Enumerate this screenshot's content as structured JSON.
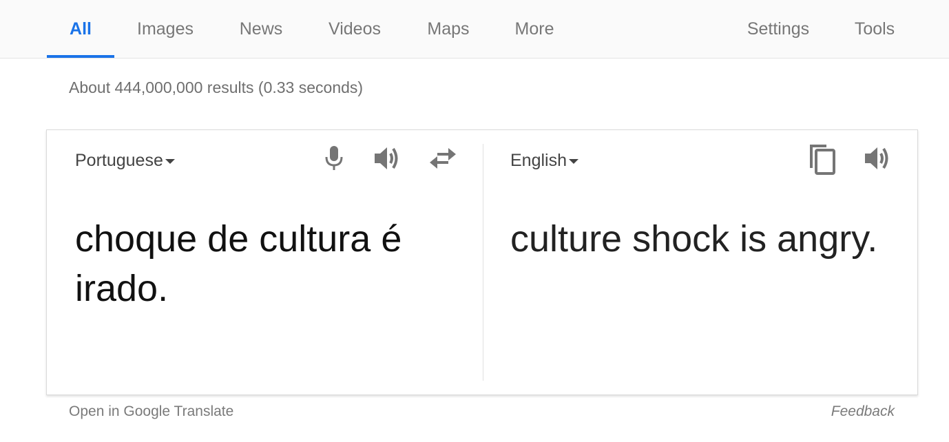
{
  "tabs": {
    "all": "All",
    "images": "Images",
    "news": "News",
    "videos": "Videos",
    "maps": "Maps",
    "more": "More",
    "settings": "Settings",
    "tools": "Tools",
    "active": "All"
  },
  "result_stats": "About 444,000,000 results (0.33 seconds)",
  "translate": {
    "source_language": "Portuguese",
    "target_language": "English",
    "source_text": "choque de cultura é irado.",
    "target_text": "culture shock is angry.",
    "icons": {
      "microphone": "microphone-icon",
      "source_speaker": "speaker-icon",
      "swap": "swap-arrows-icon",
      "copy": "copy-icon",
      "target_speaker": "speaker-icon"
    }
  },
  "footer": {
    "open_link": "Open in Google Translate",
    "feedback": "Feedback"
  },
  "colors": {
    "accent": "#1a73e8",
    "icon_gray": "#757575",
    "tab_text": "#777777"
  }
}
